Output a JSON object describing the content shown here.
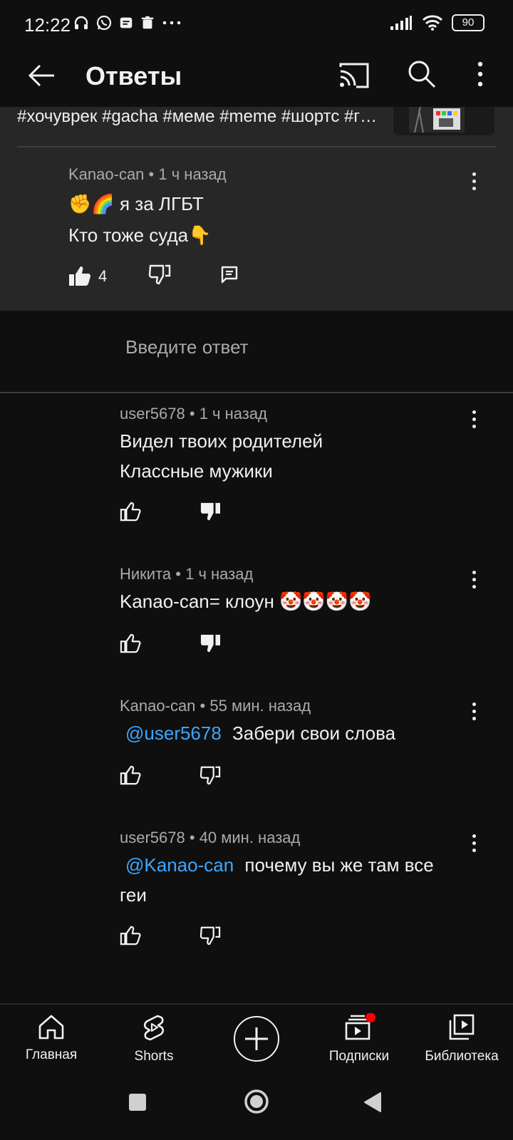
{
  "status_bar": {
    "time": "12:22",
    "battery": "90"
  },
  "header": {
    "title": "Ответы"
  },
  "video": {
    "hashtags": "#хочуврек #gacha #меме #meme #шортс #г…"
  },
  "parent_comment": {
    "author": "Kanao-can",
    "time": "1 ч назад",
    "line1": "✊🌈 я за ЛГБТ",
    "line2": "Кто тоже суда👇",
    "likes": "4"
  },
  "reply_input": {
    "placeholder": "Введите ответ"
  },
  "replies": [
    {
      "author": "user5678",
      "time": "1 ч назад",
      "line1": "Видел твоих родителей",
      "line2": "Классные мужики",
      "mention": "",
      "disliked": true
    },
    {
      "author": "Никита",
      "time": "1 ч назад",
      "line1": "Kanao-can= клоун 🤡🤡🤡🤡",
      "line2": "",
      "mention": "",
      "disliked": true
    },
    {
      "author": "Kanao-can",
      "time": "55 мин. назад",
      "line1": "Забери свои слова",
      "line2": "",
      "mention": "@user5678",
      "disliked": false
    },
    {
      "author": "user5678",
      "time": "40 мин. назад",
      "line1": "почему вы же там все",
      "line2": "геи",
      "mention": "@Kanao-can",
      "disliked": false
    }
  ],
  "bottom_nav": {
    "home": "Главная",
    "shorts": "Shorts",
    "subscriptions": "Подписки",
    "library": "Библиотека"
  },
  "colors": {
    "background": "#0f0f0f",
    "surface": "#272727",
    "mention": "#3ea6ff",
    "notification_dot": "#ff0000"
  }
}
